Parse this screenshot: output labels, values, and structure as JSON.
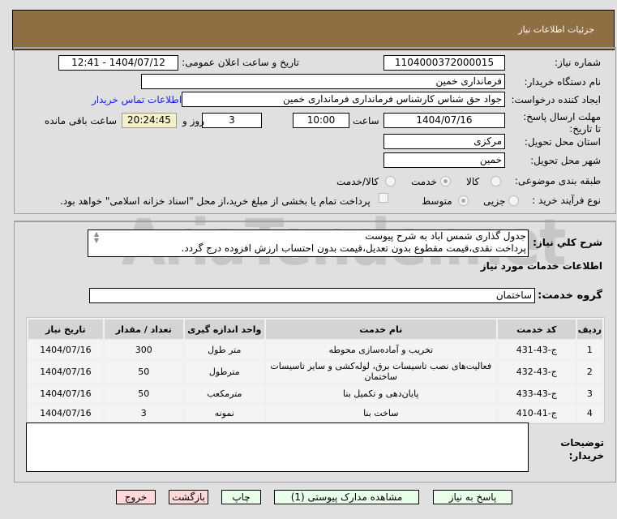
{
  "header": {
    "title": "جزئیات اطلاعات نیاز"
  },
  "form": {
    "need_number_label": "شماره نیاز:",
    "need_number": "1104000372000015",
    "announce_label": "تاریخ و ساعت اعلان عمومی:",
    "announce_value": "1404/07/12 - 12:41",
    "buyer_label": "نام دستگاه خریدار:",
    "buyer": "فرمانداری خمین",
    "requester_label": "ایجاد کننده درخواست:",
    "requester": "جواد حق شناس کارشناس فرمانداری فرمانداری خمین",
    "contact_link": "اطلاعات تماس خریدار",
    "deadline_label": "مهلت ارسال پاسخ: تا تاریخ:",
    "deadline_date": "1404/07/16",
    "time_label": "ساعت",
    "deadline_time": "10:00",
    "days": "3",
    "days_label": "روز و",
    "remaining": "20:24:45",
    "remaining_label": "ساعت باقی مانده",
    "province_label": "استان محل تحویل:",
    "province": "مرکزی",
    "city_label": "شهر محل تحویل:",
    "city": "خمین",
    "category_label": "طبقه بندی موضوعی:",
    "category_options": [
      "کالا",
      "خدمت",
      "کالا/خدمت"
    ],
    "category_selected": "خدمت",
    "process_label": "نوع فرآیند خرید :",
    "process_options": [
      "جزیی",
      "متوسط"
    ],
    "process_selected": "متوسط",
    "payment_note": "پرداخت تمام یا بخشی از مبلغ خرید،از محل \"اسناد خزانه اسلامی\" خواهد بود."
  },
  "description": {
    "label": "شرح کلي نياز:",
    "line1": "جدول گذاری شمس اباد به شرح پیوست",
    "line2": "پرداخت نقدی،قیمت مقطوع بدون تعدیل،قیمت بدون احتساب ارزش افزوده درج گردد."
  },
  "services": {
    "title": "اطلاعات خدمات مورد نیاز",
    "group_label": "گروه خدمت:",
    "group": "ساختمان",
    "columns": [
      "ردیف",
      "کد خدمت",
      "نام خدمت",
      "واحد اندازه گیری",
      "تعداد / مقدار",
      "تاریخ نیاز"
    ],
    "rows": [
      [
        "1",
        "ج-43-431",
        "تخریب و آماده‌سازی محوطه",
        "متر طول",
        "300",
        "1404/07/16"
      ],
      [
        "2",
        "ج-43-432",
        "فعالیت‌های نصب تاسیسات برق، لوله‌کشی و سایر تاسیسات ساختمان",
        "مترطول",
        "50",
        "1404/07/16"
      ],
      [
        "3",
        "ج-43-433",
        "پایان‌دهی و تکمیل بنا",
        "مترمکعب",
        "50",
        "1404/07/16"
      ],
      [
        "4",
        "ج-41-410",
        "ساخت بنا",
        "نمونه",
        "3",
        "1404/07/16"
      ]
    ]
  },
  "notes": {
    "label": "توضیحات خریدار:",
    "value": ""
  },
  "buttons": {
    "reply": "پاسخ به نیاز",
    "attachments": "مشاهده مدارک پیوستی (1)",
    "print": "چاپ",
    "back": "بازگشت",
    "exit": "خروج"
  },
  "watermark": "AriaTender.net"
}
